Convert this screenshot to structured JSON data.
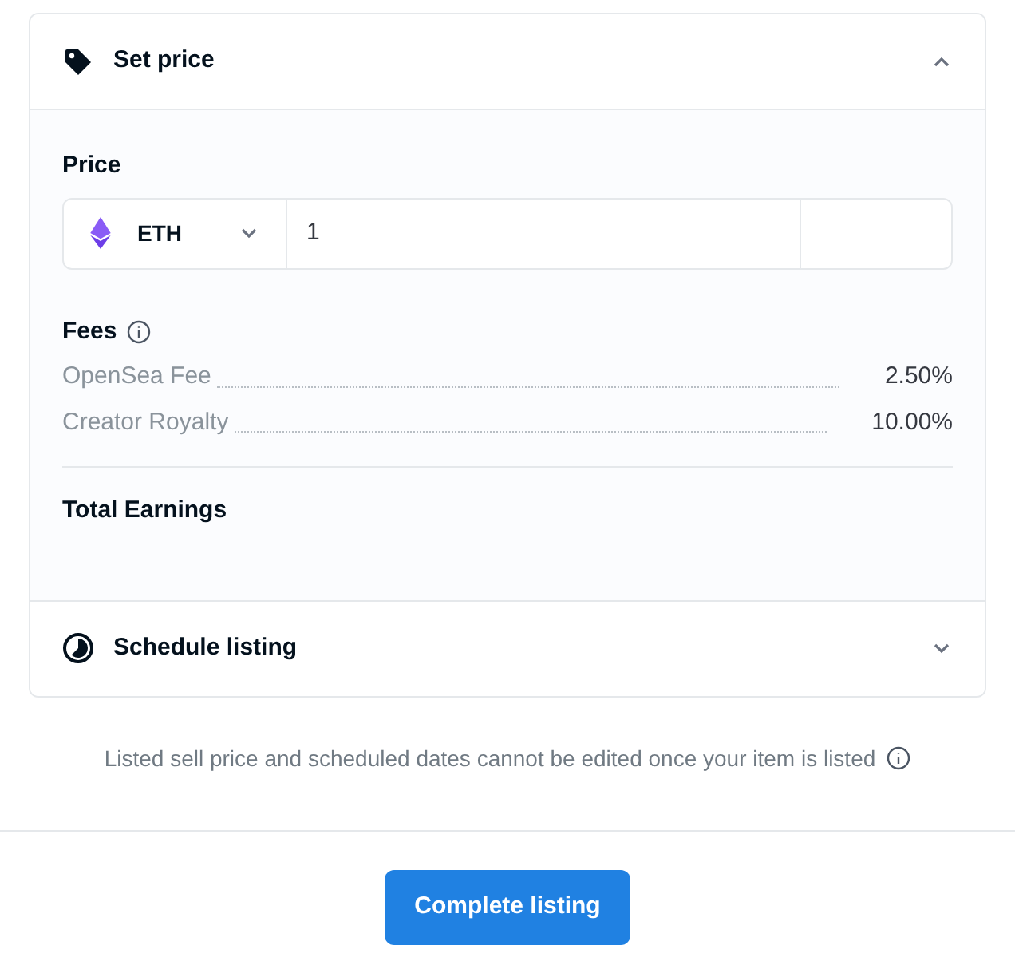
{
  "sections": [
    {
      "kind": "price",
      "title": "Set price",
      "expanded": true,
      "price_label": "Price",
      "currency": "ETH",
      "value": "1",
      "fees_label": "Fees",
      "fees": [
        {
          "name": "OpenSea Fee",
          "value": "2.50%"
        },
        {
          "name": "Creator Royalty",
          "value": "10.00%"
        }
      ],
      "total_label": "Total Earnings"
    },
    {
      "kind": "schedule",
      "title": "Schedule listing",
      "expanded": false
    }
  ],
  "note": "Listed sell price and scheduled dates cannot be edited once your item is listed",
  "button": "Complete listing"
}
